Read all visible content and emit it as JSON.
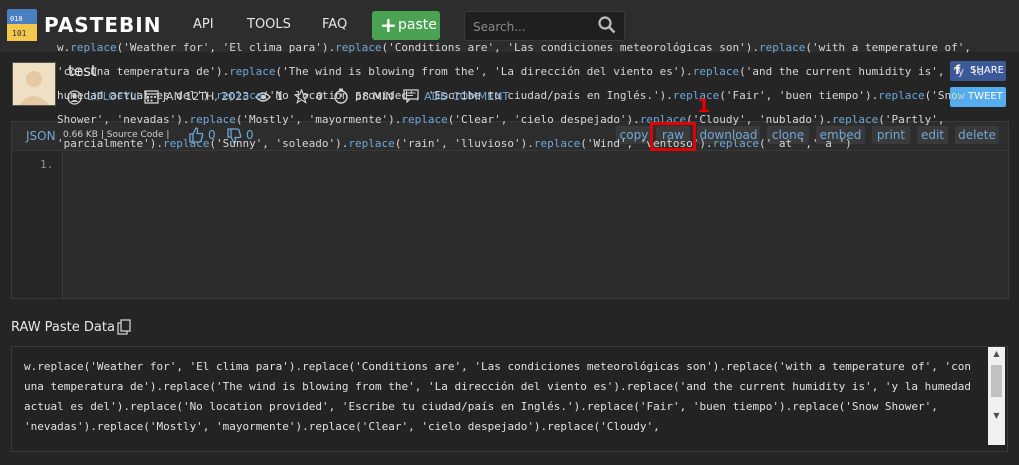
{
  "header": {
    "logo_text": "PASTEBIN",
    "nav": [
      "API",
      "TOOLS",
      "FAQ"
    ],
    "paste_button": "paste",
    "search_placeholder": "Search..."
  },
  "paste": {
    "title": "test",
    "author": "LIFLOFYLI",
    "date": "JAN 12TH, 2023",
    "views": "1",
    "stars": "0",
    "expiry": "58 MIN",
    "add_comment": "ADD COMMENT",
    "share": "SHARE",
    "tweet": "TWEET"
  },
  "code_header": {
    "syntax": "JSON",
    "info": "0.66 KB | Source Code |",
    "likes": "0",
    "dislikes": "0",
    "actions": [
      "copy",
      "raw",
      "download",
      "clone",
      "embed",
      "print",
      "edit",
      "delete"
    ]
  },
  "annotation": {
    "number": "1",
    "color": "#e00000"
  },
  "code": {
    "line_number": "1.",
    "text": "w.replace('Weather for', 'El clima para').replace('Conditions are', 'Las condiciones meteorológicas son').replace('with a temperature of', 'con una temperatura de').replace('The wind is blowing from the', 'La dirección del viento es').replace('and the current humidity is', 'y la humedad actual es del').replace('No location provided', 'Escribe tu ciudad/país en Inglés.').replace('Fair', 'buen tiempo').replace('Snow Shower', 'nevadas').replace('Mostly', 'mayormente').replace('Clear', 'cielo despejado').replace('Cloudy', 'nublado').replace('Partly', 'parcialmente').replace('Sunny', 'soleado').replace('rain', 'lluvioso').replace('Wind', 'ventoso').replace(' at ',' a ')"
  },
  "raw": {
    "title": "RAW Paste Data",
    "text": "w.replace('Weather for', 'El clima para').replace('Conditions are', 'Las condiciones meteorológicas son').replace('with a temperature of', 'con una temperatura de').replace('The wind is blowing from the', 'La dirección del viento es').replace('and the current humidity is', 'y la humedad actual es del').replace('No location provided', 'Escribe tu ciudad/país en Inglés.').replace('Fair', 'buen tiempo').replace('Snow Shower', 'nevadas').replace('Mostly', 'mayormente').replace('Clear', 'cielo despejado').replace('Cloudy',"
  }
}
